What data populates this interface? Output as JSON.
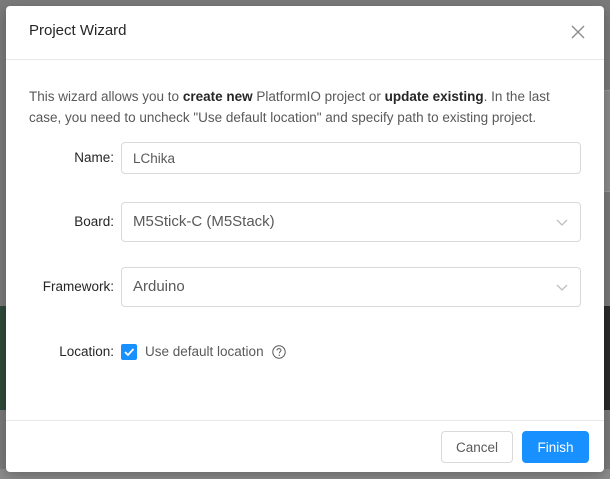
{
  "modal": {
    "title": "Project Wizard",
    "intro": {
      "part1": "This wizard allows you to ",
      "bold1": "create new",
      "part2": " PlatformIO project or ",
      "bold2": "update existing",
      "part3": ". In the last case, you need to uncheck \"Use default location\" and specify path to existing project."
    },
    "form": {
      "name": {
        "label": "Name:",
        "value": "LChika"
      },
      "board": {
        "label": "Board:",
        "value": "M5Stick-C (M5Stack)"
      },
      "framework": {
        "label": "Framework:",
        "value": "Arduino"
      },
      "location": {
        "label": "Location:",
        "checkbox_label": "Use default location",
        "checked": true
      }
    },
    "footer": {
      "cancel_label": "Cancel",
      "finish_label": "Finish"
    }
  },
  "colors": {
    "primary": "#1890ff",
    "border": "#d9d9d9",
    "text": "#595959",
    "overlay": "#7a7a7a"
  },
  "icons": {
    "close": "close-icon",
    "dropdown": "chevron-down-icon",
    "check": "check-icon",
    "help": "question-circle-icon"
  }
}
